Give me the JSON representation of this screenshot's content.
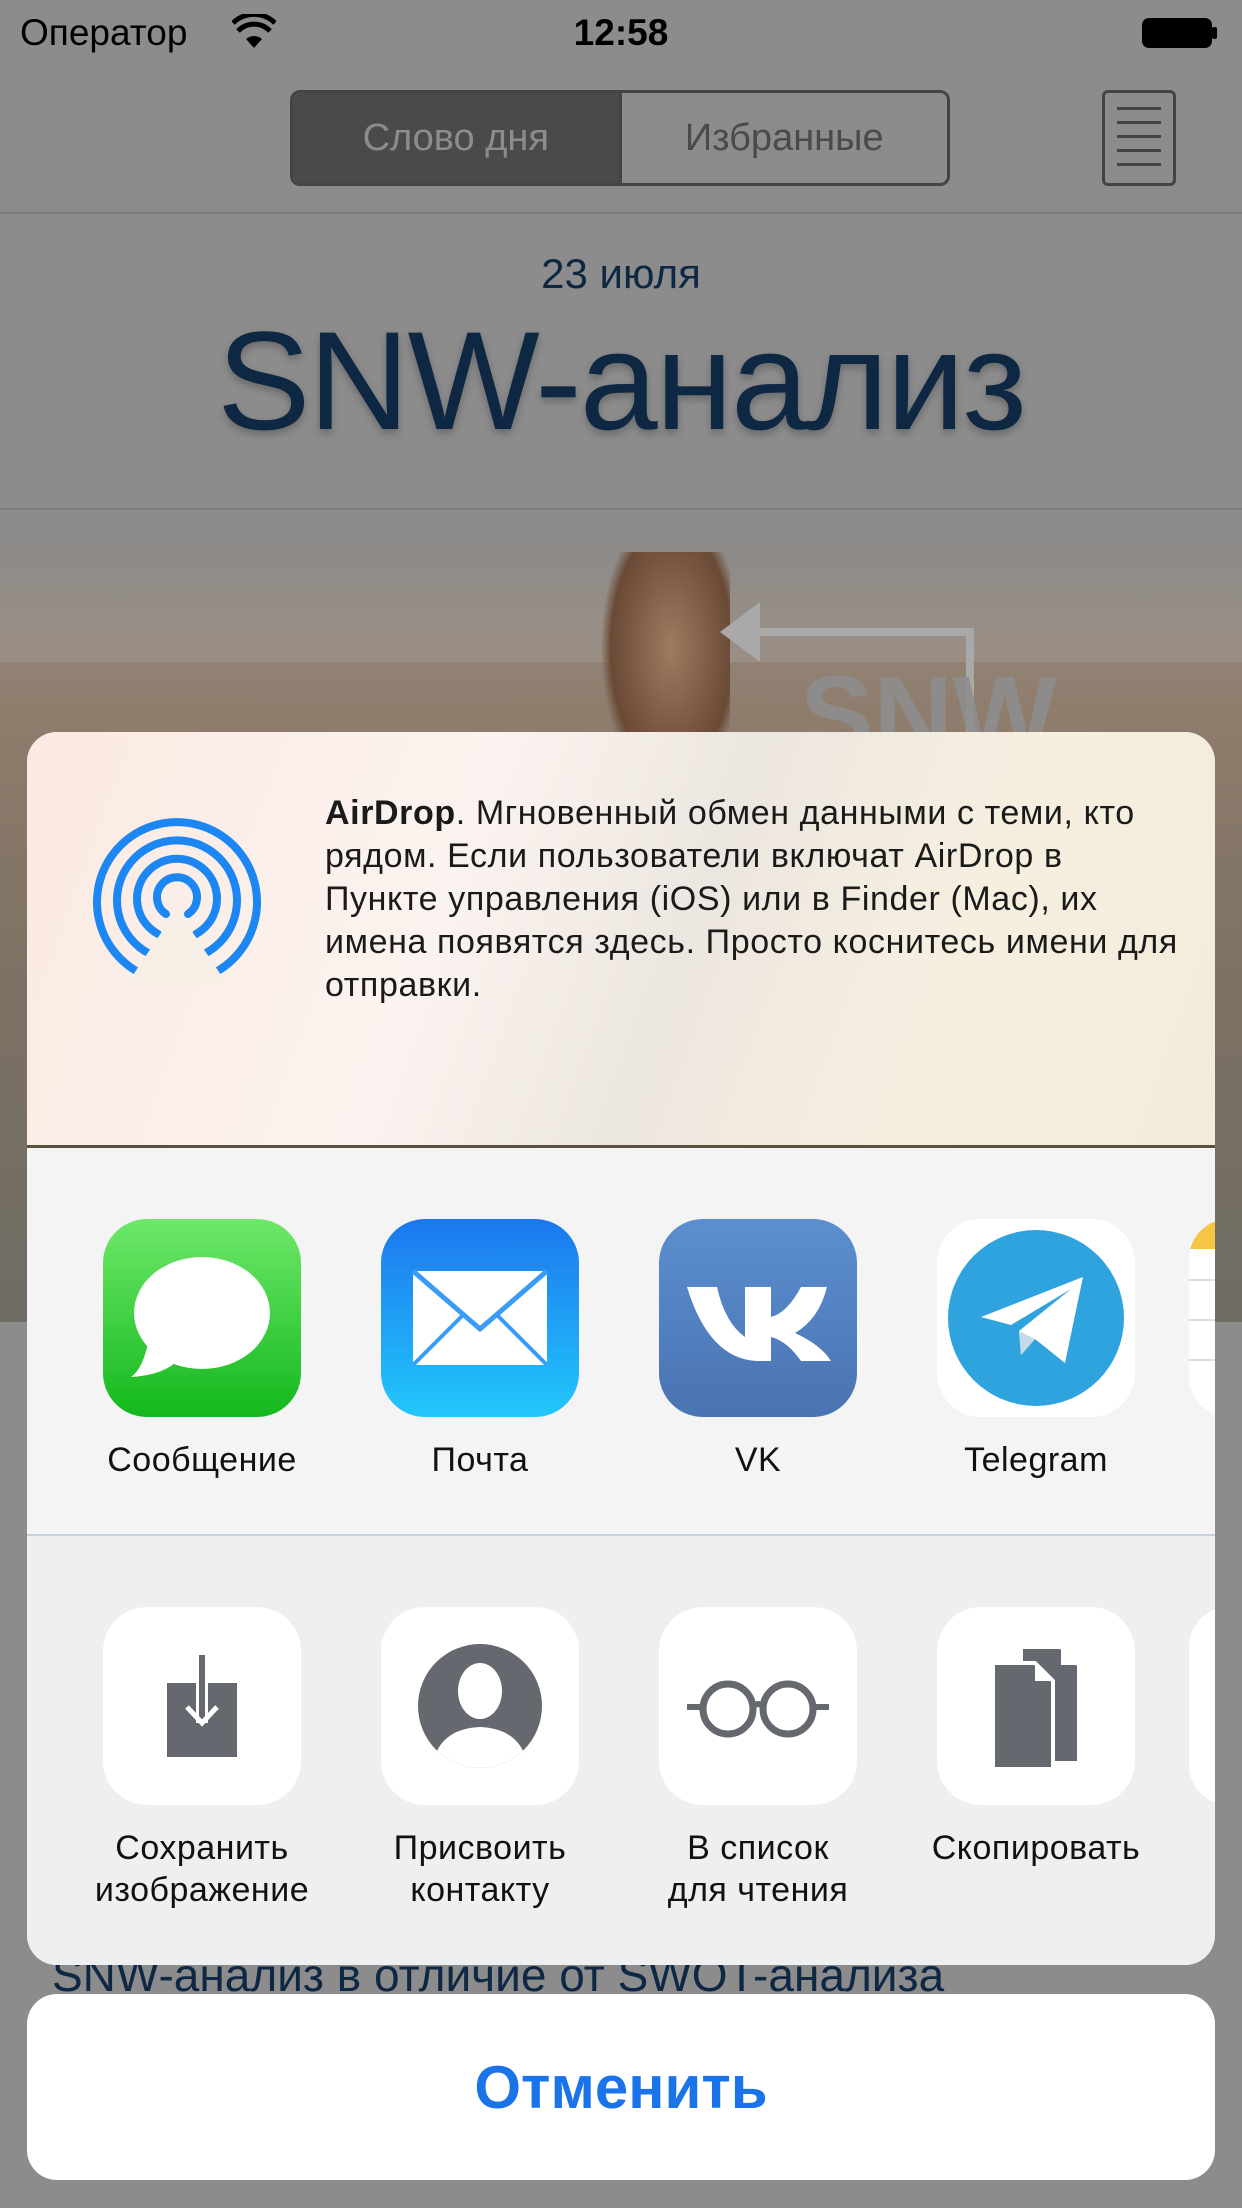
{
  "status": {
    "carrier": "Оператор",
    "time": "12:58"
  },
  "app": {
    "tabs": [
      "Слово дня",
      "Избранные"
    ],
    "date": "23 июля",
    "title": "SNW-анализ",
    "hero_watermark": "SNW",
    "bottom_text": "SNW-анализ в отличие от SWOT-анализа"
  },
  "share": {
    "airdrop_title": "AirDrop",
    "airdrop_text": ". Мгновенный обмен данными с теми, кто рядом. Если пользователи включат AirDrop в Пункте управления (iOS) или в Finder (Mac), их имена появятся здесь. Просто коснитесь имени для отправки.",
    "apps": [
      {
        "label": "Сообщение",
        "icon": "messages-icon"
      },
      {
        "label": "Почта",
        "icon": "mail-icon"
      },
      {
        "label": "VK",
        "icon": "vk-icon"
      },
      {
        "label": "Telegram",
        "icon": "telegram-icon"
      }
    ],
    "actions": [
      {
        "label1": "Сохранить",
        "label2": "изображение",
        "icon": "save-image-icon"
      },
      {
        "label1": "Присвоить",
        "label2": "контакту",
        "icon": "contact-icon"
      },
      {
        "label1": "В список",
        "label2": "для чтения",
        "icon": "reading-list-icon"
      },
      {
        "label1": "Скопировать",
        "label2": "",
        "icon": "copy-icon"
      }
    ],
    "cancel": "Отменить"
  },
  "colors": {
    "accent": "#1a73e8",
    "dimmed_background": "#8c8c8c"
  }
}
